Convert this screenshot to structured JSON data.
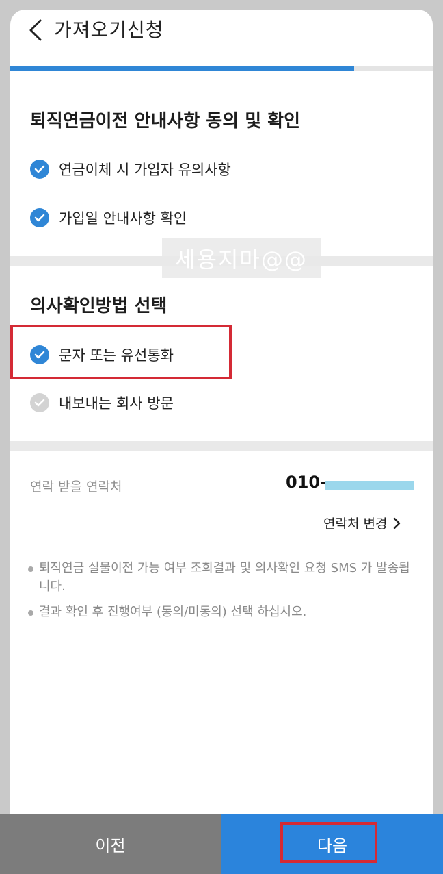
{
  "header": {
    "title": "가져오기신청",
    "back_icon": "chevron-left-icon"
  },
  "progress": {
    "fraction": 0.8
  },
  "agreement": {
    "title": "퇴직연금이전 안내사항 동의 및 확인",
    "items": [
      {
        "label": "연금이체 시 가입자 유의사항",
        "checked": true
      },
      {
        "label": "가입일 안내사항 확인",
        "checked": true
      }
    ]
  },
  "watermark": "세용지마@@",
  "method": {
    "title": "의사확인방법 선택",
    "options": [
      {
        "label": "문자 또는 유선통화",
        "checked": true
      },
      {
        "label": "내보내는 회사 방문",
        "checked": false
      }
    ]
  },
  "contact": {
    "label": "연락 받을 연락처",
    "phone_prefix": "010-",
    "change_label": "연락처 변경"
  },
  "notes": [
    "퇴직연금 실물이전 가능 여부 조회결과 및 의사확인 요청 SMS 가 발송됩니다.",
    "결과 확인 후 진행여부 (동의/미동의) 선택 하십시오."
  ],
  "buttons": {
    "prev_label": "이전",
    "next_label": "다음"
  },
  "colors": {
    "accent": "#2f86d6",
    "next_button": "#2b84dc",
    "prev_button": "#7c7c7c",
    "highlight": "#d42a35",
    "unchecked": "#d3d3d3"
  }
}
